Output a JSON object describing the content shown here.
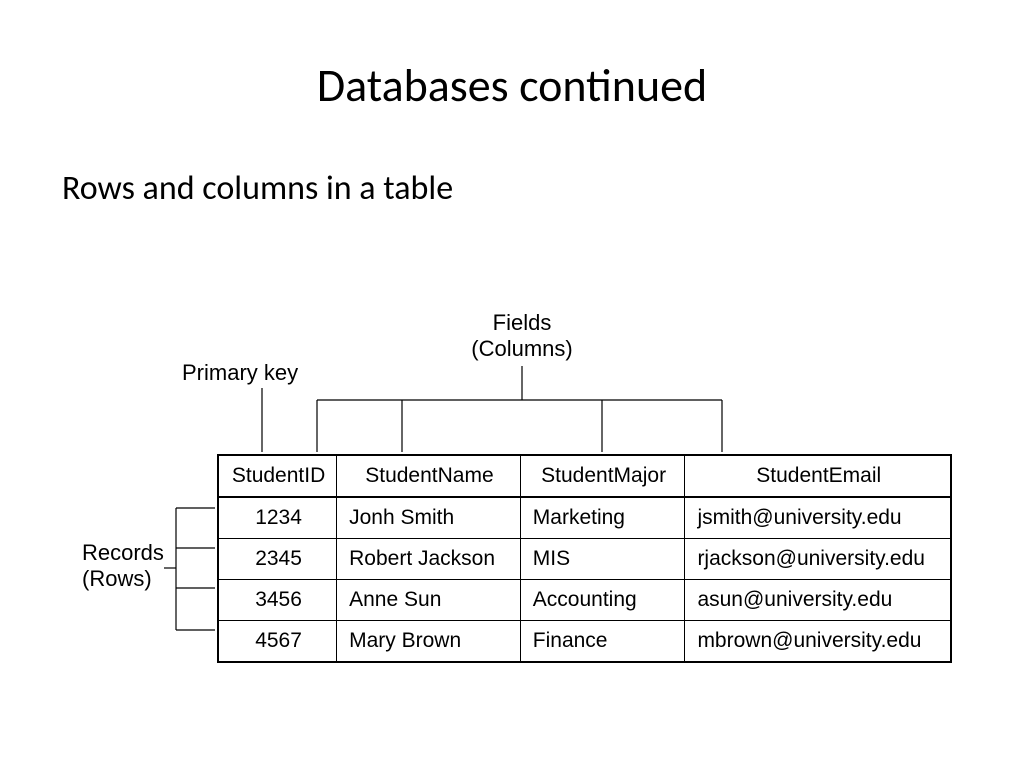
{
  "title": "Databases continued",
  "subtitle": "Rows and columns in a table",
  "labels": {
    "primary_key": "Primary key",
    "fields_line1": "Fields",
    "fields_line2": "(Columns)",
    "records_line1": "Records",
    "records_line2": "(Rows)"
  },
  "table": {
    "headers": [
      "StudentID",
      "StudentName",
      "StudentMajor",
      "StudentEmail"
    ],
    "rows": [
      {
        "id": "1234",
        "name": "Jonh Smith",
        "major": "Marketing",
        "email": "jsmith@university.edu"
      },
      {
        "id": "2345",
        "name": "Robert Jackson",
        "major": "MIS",
        "email": "rjackson@university.edu"
      },
      {
        "id": "3456",
        "name": "Anne Sun",
        "major": "Accounting",
        "email": "asun@university.edu"
      },
      {
        "id": "4567",
        "name": "Mary Brown",
        "major": "Finance",
        "email": "mbrown@university.edu"
      }
    ]
  }
}
